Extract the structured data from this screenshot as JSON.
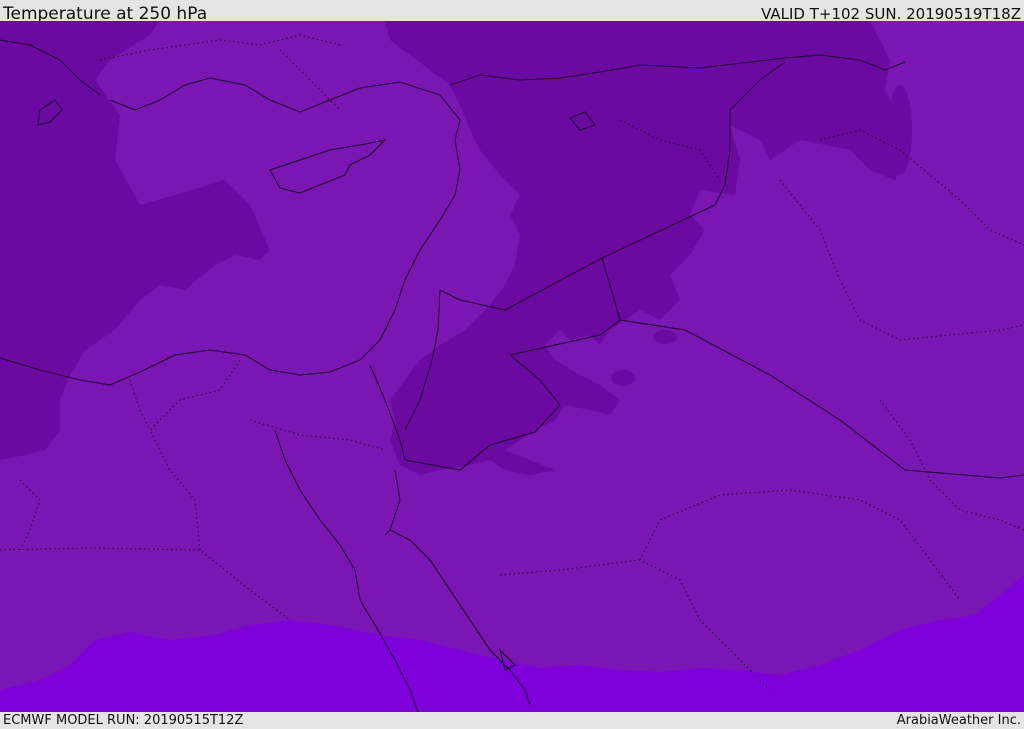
{
  "header": {
    "title": "Temperature at 250 hPa",
    "valid": "VALID T+102 SUN. 20190519T18Z"
  },
  "footer": {
    "model_run": "ECMWF MODEL RUN: 20190515T12Z",
    "credit": "ArabiaWeather Inc."
  },
  "colors": {
    "base_fill": "#7a16b2",
    "cold_fill": "#6a0aa0",
    "cooler_fill": "#7e00da",
    "coastline": "#1a0a24",
    "borders": "#1a0a24"
  }
}
